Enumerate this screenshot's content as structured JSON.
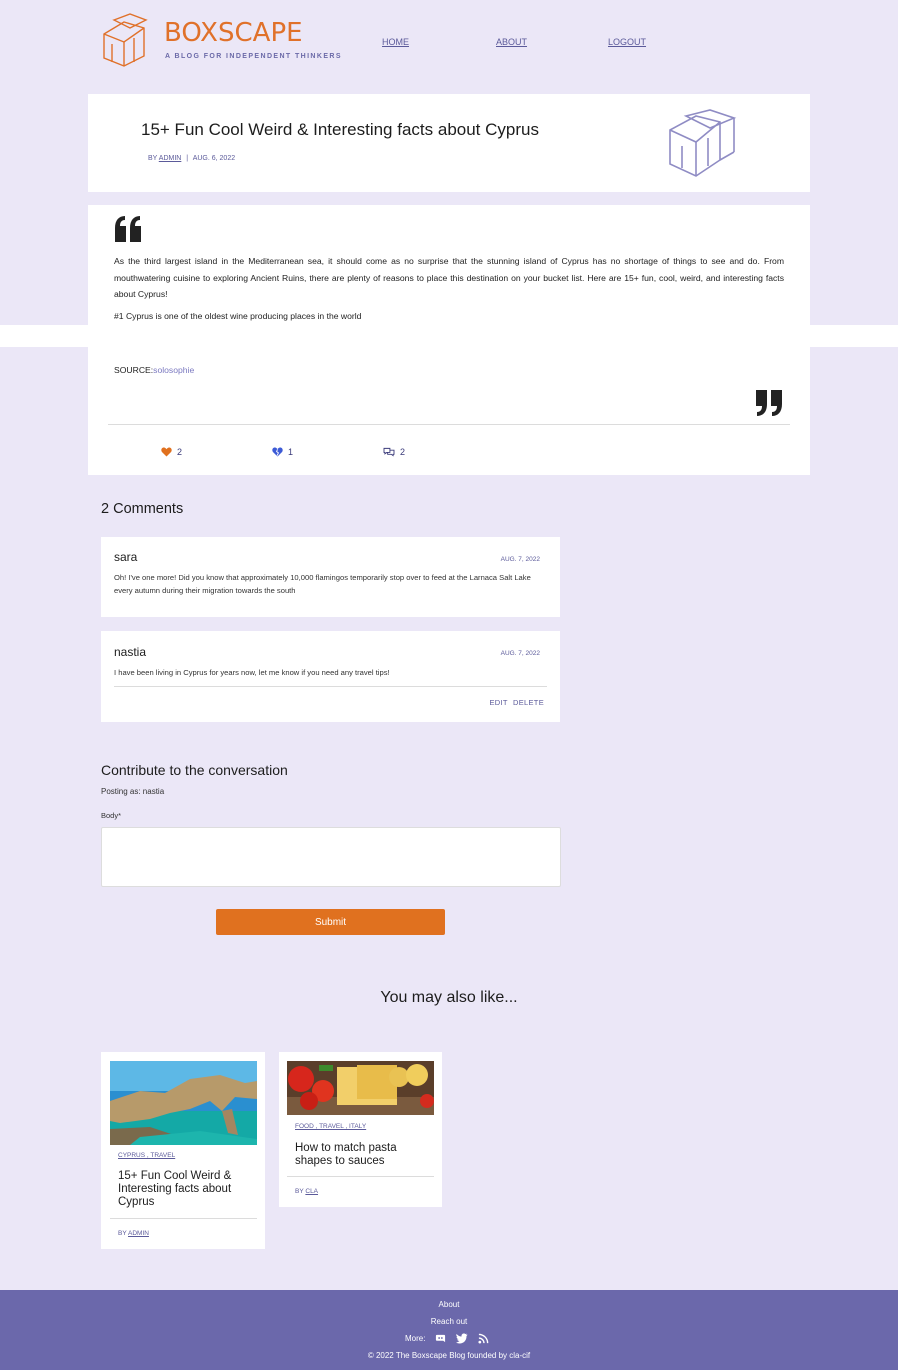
{
  "header": {
    "logo_text": "BOXSCAPE",
    "logo_tagline": "A BLOG FOR INDEPENDENT THINKERS",
    "nav": [
      "HOME",
      "ABOUT",
      "LOGOUT"
    ]
  },
  "post": {
    "title": "15+ Fun Cool Weird & Interesting facts about Cyprus",
    "by": "BY",
    "author": "ADMIN",
    "date": "AUG. 6, 2022",
    "paragraph": "As the third largest island in the Mediterranean sea, it should come as no surprise that the stunning island of Cyprus has no shortage of things to see and do. From mouthwatering cuisine to exploring Ancient Ruins, there are plenty of reasons to place this destination on your bucket list. Here are 15+ fun, cool, weird, and interesting facts about Cyprus!",
    "fact1": "#1 Cyprus is one of the oldest wine producing places in the world",
    "source_label": "SOURCE:",
    "source_name": "solosophie",
    "likes": "2",
    "dislikes": "1",
    "comments_count": "2"
  },
  "comments": {
    "title": "2 Comments",
    "items": [
      {
        "author": "sara",
        "date": "AUG. 7, 2022",
        "text": "Oh! I've one more! Did you know that approximately 10,000 flamingos temporarily stop over to feed at the Larnaca Salt Lake every autumn during their migration towards the south"
      },
      {
        "author": "nastia",
        "date": "AUG. 7, 2022",
        "text": "I have been living in Cyprus for years now, let me know if you need any travel tips!",
        "edit": "EDIT",
        "delete": "DELETE"
      }
    ]
  },
  "form": {
    "title": "Contribute to the conversation",
    "posting_as": "Posting as: nastia",
    "body_label": "Body*",
    "submit": "Submit"
  },
  "related": {
    "title": "You may also like...",
    "items": [
      {
        "tags": "CYPRUS , TRAVEL",
        "title": "15+ Fun Cool Weird & Interesting facts about Cyprus",
        "by": "BY",
        "author": "ADMIN"
      },
      {
        "tags": "FOOD , TRAVEL , ITALY",
        "title": "How to match pasta shapes to sauces",
        "by": "BY",
        "author": "CLA"
      }
    ]
  },
  "footer": {
    "about": "About",
    "reach_out": "Reach out",
    "more": "More:",
    "copyright": "© 2022 The Boxscape Blog founded by cla-cif"
  },
  "colors": {
    "accent": "#e0711f",
    "brand_purple": "#6b68ab",
    "background": "#ebe7f7"
  }
}
